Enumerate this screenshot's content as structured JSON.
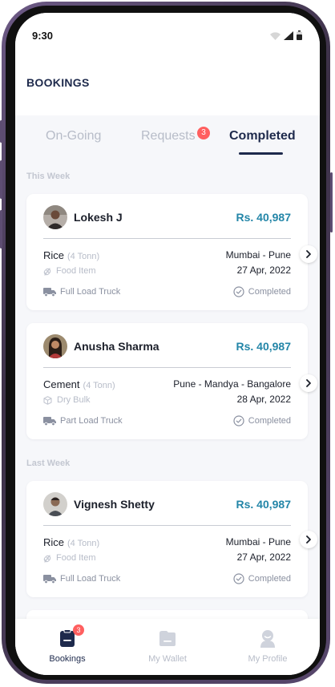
{
  "status_bar": {
    "time": "9:30"
  },
  "header": {
    "title": "BOOKINGS"
  },
  "tabs": [
    {
      "label": "On-Going",
      "active": false
    },
    {
      "label": "Requests",
      "badge": "3",
      "active": false
    },
    {
      "label": "Completed",
      "active": true
    }
  ],
  "sections": {
    "this_week": "This Week",
    "last_week": "Last Week"
  },
  "bookings": [
    {
      "name": "Lokesh J",
      "price": "Rs. 40,987",
      "goods": "Rice",
      "quantity": "(4 Tonn)",
      "category": "Food Item",
      "route": "Mumbai - Pune",
      "date": "27 Apr, 2022",
      "truck_type": "Full Load Truck",
      "status": "Completed"
    },
    {
      "name": "Anusha Sharma",
      "price": "Rs. 40,987",
      "goods": "Cement",
      "quantity": "(4 Tonn)",
      "category": "Dry Bulk",
      "route": "Pune - Mandya - Bangalore",
      "date": "28 Apr, 2022",
      "truck_type": "Part Load Truck",
      "status": "Completed"
    },
    {
      "name": "Vignesh Shetty",
      "price": "Rs. 40,987",
      "goods": "Rice",
      "quantity": "(4 Tonn)",
      "category": "Food Item",
      "route": "Mumbai - Pune",
      "date": "27 Apr, 2022",
      "truck_type": "Full Load Truck",
      "status": "Completed"
    }
  ],
  "bottom_nav": [
    {
      "label": "Bookings",
      "icon": "clipboard-icon",
      "badge": "3",
      "active": true
    },
    {
      "label": "My Wallet",
      "icon": "wallet-icon",
      "active": false
    },
    {
      "label": "My Profile",
      "icon": "profile-icon",
      "active": false
    }
  ],
  "colors": {
    "primary": "#1e2a4c",
    "price": "#2486a8",
    "badge": "#ff5f5f",
    "muted": "#b7bcc8",
    "background": "#f6f7fa"
  }
}
